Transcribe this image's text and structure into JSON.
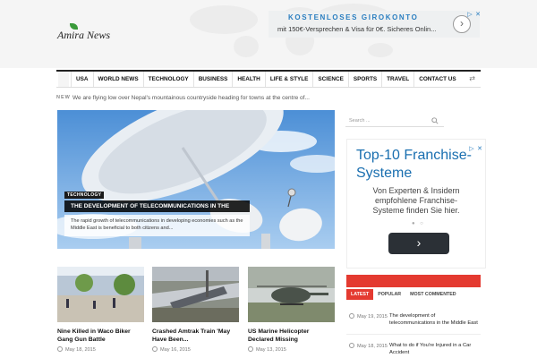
{
  "logo": {
    "text": "Amira News"
  },
  "top_ad": {
    "headline": "KOSTENLOSES GIROKONTO",
    "subline": "mit 150€-Versprechen & Visa für 0€. Sicheres Onlin...",
    "button": "›"
  },
  "nav": {
    "items": [
      "USA",
      "WORLD NEWS",
      "TECHNOLOGY",
      "BUSINESS",
      "HEALTH",
      "LIFE & STYLE",
      "SCIENCE",
      "SPORTS",
      "TRAVEL",
      "CONTACT US"
    ],
    "shuffle_icon": "shuffle-icon"
  },
  "ticker": {
    "label": "NEW",
    "text": "We are flying low over Nepal's mountainous countryside heading for towns at the centre of..."
  },
  "hero": {
    "category": "TECHNOLOGY",
    "title": "THE DEVELOPMENT OF TELECOMMUNICATIONS IN THE",
    "excerpt": "The rapid growth of telecommunications in developing economies such as the Middle East is beneficial to both citizens and..."
  },
  "cards": [
    {
      "title": "Nine Killed in Waco Biker Gang Gun Battle",
      "date": "May 18, 2015"
    },
    {
      "title": "Crashed Amtrak Train 'May Have Been...",
      "date": "May 16, 2015"
    },
    {
      "title": "US Marine Helicopter Declared Missing",
      "date": "May 13, 2015"
    }
  ],
  "search": {
    "placeholder": "Search ..."
  },
  "side_ad": {
    "headline": "Top-10 Franchise-Systeme",
    "body": "Von Experten & Insidern empfohlene Franchise-Systeme finden Sie hier.",
    "button": "›"
  },
  "tabs": {
    "items": [
      "LATEST",
      "POPULAR",
      "MOST COMMENTED"
    ],
    "active": "LATEST"
  },
  "latest": [
    {
      "date": "May 19, 2015",
      "title": "The development of telecommunications in the Middle East"
    },
    {
      "date": "May 18, 2015",
      "title": "What to do if You're Injured in a Car Accident"
    }
  ],
  "colors": {
    "accent": "#e43a30",
    "nav_border": "#222222",
    "ad_blue": "#1a6fb0"
  }
}
